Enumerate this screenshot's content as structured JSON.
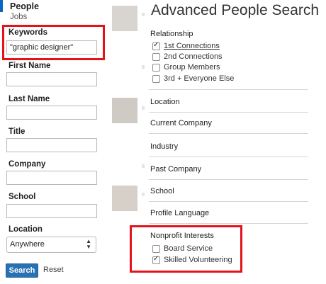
{
  "nav": {
    "people": "People",
    "jobs": "Jobs"
  },
  "form": {
    "keywords_label": "Keywords",
    "keywords_value": "\"graphic designer\"",
    "first_name_label": "First Name",
    "last_name_label": "Last Name",
    "title_label": "Title",
    "company_label": "Company",
    "school_label": "School",
    "location_label": "Location",
    "location_value": "Anywhere",
    "search_button": "Search",
    "reset_link": "Reset"
  },
  "panel": {
    "title": "Advanced People Search",
    "relationship_label": "Relationship",
    "relationship_options": [
      {
        "label": "1st Connections",
        "checked": true
      },
      {
        "label": "2nd Connections",
        "checked": false
      },
      {
        "label": "Group Members",
        "checked": false
      },
      {
        "label": "3rd + Everyone Else",
        "checked": false
      }
    ],
    "location": "Location",
    "current_company": "Current Company",
    "industry": "Industry",
    "past_company": "Past Company",
    "school": "School",
    "profile_language": "Profile Language",
    "nonprofit_label": "Nonprofit Interests",
    "nonprofit_options": [
      {
        "label": "Board Service",
        "checked": false
      },
      {
        "label": "Skilled Volunteering",
        "checked": true
      }
    ]
  },
  "colors": {
    "highlight": "#e4131b",
    "button": "#2871b3"
  }
}
